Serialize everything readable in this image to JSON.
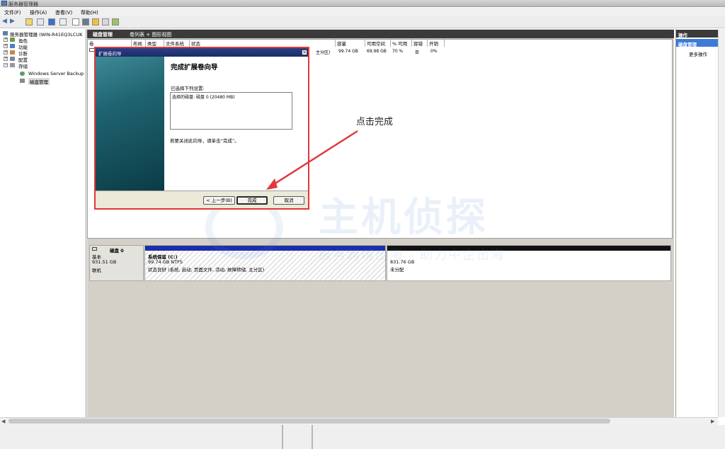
{
  "window": {
    "title": "服务器管理器"
  },
  "menu": [
    "文件(F)",
    "操作(A)",
    "查看(V)",
    "帮助(H)"
  ],
  "tree": {
    "root": "服务器管理器 (WIN-R41EQ3LCUK",
    "items": [
      "角色",
      "功能",
      "诊断",
      "配置",
      "存储"
    ],
    "storage_children": [
      "Windows Server Backup",
      "磁盘管理"
    ]
  },
  "header": {
    "title": "磁盘管理",
    "view": "卷列表 + 图形视图"
  },
  "list": {
    "columns": [
      "卷",
      "布局",
      "类型",
      "文件系统",
      "状态",
      "容量",
      "可用空间",
      "% 可用",
      "容错",
      "开销"
    ],
    "row": {
      "status_tail": "主分区)",
      "capacity": "99.74 GB",
      "free": "69.98 GB",
      "pct": "70 %",
      "fault": "否",
      "overhead": "0%"
    }
  },
  "disk": {
    "name": "磁盘 0",
    "type": "基本",
    "size": "931.51 GB",
    "state": "联机",
    "volume1": {
      "name": "系统保留  (C:)",
      "size": "99.74 GB NTFS",
      "status": "状态良好 (系统, 启动, 页面文件, 活动, 故障转储, 主分区)"
    },
    "volume2": {
      "size": "831.76 GB",
      "status": "未分配"
    }
  },
  "actions": {
    "title": "操作",
    "selected": "磁盘管理",
    "more": "更多操作"
  },
  "wizard": {
    "title": "扩展卷向导",
    "heading": "完成扩展卷向导",
    "selected_label": "已选择下列设置:",
    "selected_value": "选择的磁盘: 磁盘 0 (20480 MB)",
    "note": "若要关闭此向导，请单击“完成”。",
    "back": "< 上一步(B)",
    "finish": "完成",
    "cancel": "取消"
  },
  "annotation": {
    "text": "点击完成"
  },
  "watermark": {
    "big": "主机侦探",
    "small": "服务跨境出海 · 助力中企出海"
  }
}
